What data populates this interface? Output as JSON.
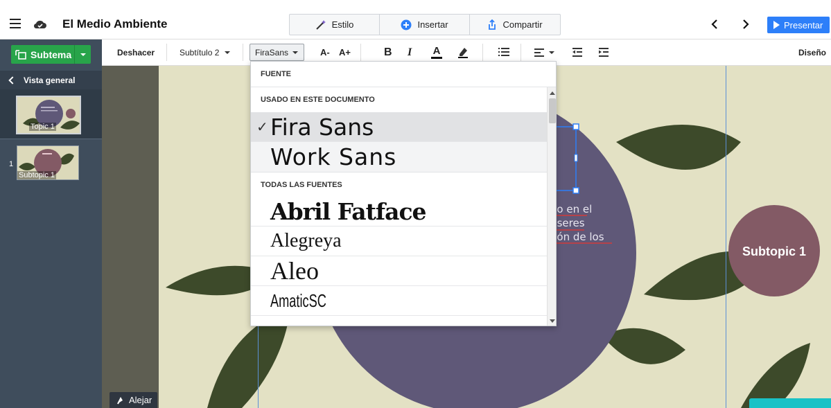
{
  "app": {
    "document_title": "El Medio Ambiente"
  },
  "top_tabs": [
    {
      "label": "Estilo",
      "icon": "magic-wand-icon"
    },
    {
      "label": "Insertar",
      "icon": "plus-circle-icon"
    },
    {
      "label": "Compartir",
      "icon": "share-icon"
    }
  ],
  "present": {
    "label": "Presentar"
  },
  "toolbar": {
    "undo_label": "Deshacer",
    "style_label": "Subtítulo 2",
    "font_label": "FiraSans",
    "decrease_font": "A-",
    "increase_font": "A+",
    "bold": "B",
    "italic": "I",
    "text_color": "A",
    "design_label": "Diseño"
  },
  "sidebar": {
    "add_button_label": "Subtema",
    "overview_label": "Vista general",
    "thumbnails": [
      {
        "label": "Topic 1",
        "number": ""
      },
      {
        "label": "Subtopic 1",
        "number": "1"
      }
    ]
  },
  "canvas": {
    "subtopic_label": "Subtopic 1",
    "body_lines": [
      "cio en el",
      "s seres",
      "ción de los"
    ],
    "zoom_out_label": "Alejar"
  },
  "font_dropdown": {
    "header": "FUENTE",
    "section_used": "USADO EN ESTE DOCUMENTO",
    "used_fonts": [
      {
        "label": "Fira Sans",
        "selected": true
      },
      {
        "label": "Work Sans",
        "selected": false
      }
    ],
    "section_all": "TODAS LAS FUENTES",
    "all_fonts": [
      "Abril Fatface",
      "Alegreya",
      "Aleo",
      "AmaticSC"
    ]
  },
  "colors": {
    "accent_blue": "#2d7ff9",
    "green_button": "#28a44a",
    "sidebar_bg": "#3f4d5c",
    "slide_bg": "#e3e1c4",
    "purple_circle": "#5f5878",
    "subtopic_circle": "#835a65",
    "leaf_green": "#3d4a2a"
  }
}
